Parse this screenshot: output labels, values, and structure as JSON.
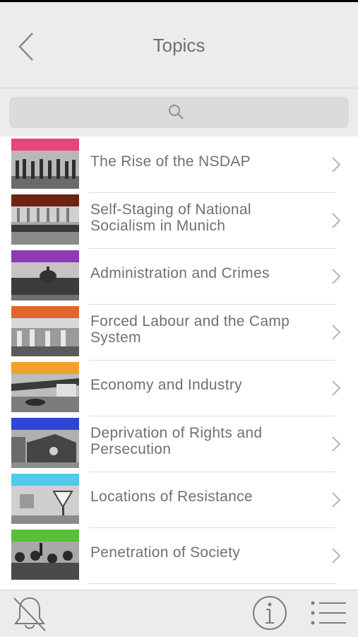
{
  "header": {
    "title": "Topics",
    "back_icon": "chevron-left-icon"
  },
  "search": {
    "placeholder": "",
    "icon": "search-icon"
  },
  "topics": [
    {
      "label": "The Rise of the NSDAP",
      "color": "#e8457a"
    },
    {
      "label": "Self-Staging of National Socialism in Munich",
      "color": "#6b2412"
    },
    {
      "label": "Administration and Crimes",
      "color": "#8e3bb2"
    },
    {
      "label": "Forced Labour and the Camp System",
      "color": "#e0662a"
    },
    {
      "label": "Economy and Industry",
      "color": "#f2a12c"
    },
    {
      "label": "Deprivation of Rights and Persecution",
      "color": "#2c47d4"
    },
    {
      "label": "Locations of Resistance",
      "color": "#54c8ea"
    },
    {
      "label": "Penetration of Society",
      "color": "#58c037"
    }
  ],
  "toolbar": {
    "left_icon": "bell-off-icon",
    "middle_icon": "info-icon",
    "right_icon": "list-menu-icon"
  }
}
